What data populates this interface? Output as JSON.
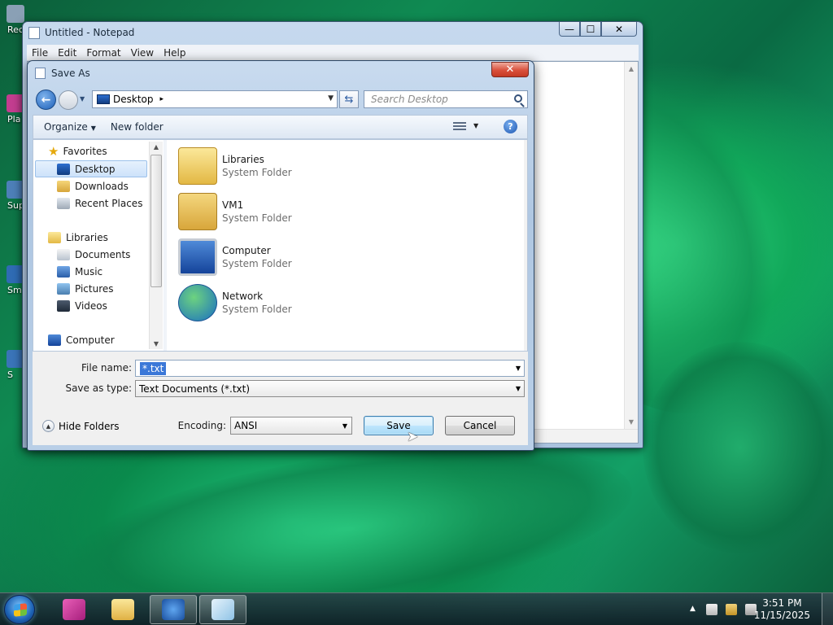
{
  "desktop": {
    "icons": [
      {
        "label": "Rec",
        "color": "#8aa0b5"
      },
      {
        "label": "Pla",
        "color": "#c23d8f"
      },
      {
        "label": "Sup",
        "color": "#4d7fb8"
      },
      {
        "label": "Sm",
        "color": "#2f6bb3"
      },
      {
        "label": "S",
        "color": "#3a74b8"
      }
    ]
  },
  "notepad": {
    "title": "Untitled - Notepad",
    "menu": [
      "File",
      "Edit",
      "Format",
      "View",
      "Help"
    ],
    "min_glyph": "—",
    "max_glyph": "☐",
    "close_glyph": "✕"
  },
  "dialog": {
    "title": "Save As",
    "close_glyph": "✕",
    "address": {
      "location": "Desktop",
      "sep": "▸",
      "dropdown": "▼"
    },
    "refresh_glyph": "⇆",
    "search_placeholder": "Search Desktop",
    "toolbar": {
      "organize": "Organize",
      "new_folder": "New folder",
      "caret": "▼"
    },
    "help_glyph": "?",
    "nav": {
      "favorites": "Favorites",
      "favorite_items": [
        "Desktop",
        "Downloads",
        "Recent Places"
      ],
      "libraries": "Libraries",
      "library_items": [
        "Documents",
        "Music",
        "Pictures",
        "Videos"
      ],
      "computer": "Computer",
      "selected": "Desktop"
    },
    "files": [
      {
        "name": "Libraries",
        "type": "System Folder",
        "icon": "libraries-folder-icon"
      },
      {
        "name": "VM1",
        "type": "System Folder",
        "icon": "user-folder-icon"
      },
      {
        "name": "Computer",
        "type": "System Folder",
        "icon": "computer-icon"
      },
      {
        "name": "Network",
        "type": "System Folder",
        "icon": "network-icon"
      }
    ],
    "file_name_label": "File name:",
    "file_name_value": "*.txt",
    "save_as_type_label": "Save as type:",
    "save_as_type_value": "Text Documents (*.txt)",
    "hide_folders": "Hide Folders",
    "encoding_label": "Encoding:",
    "encoding_value": "ANSI",
    "save": "Save",
    "cancel": "Cancel"
  },
  "taskbar": {
    "time": "3:51 PM",
    "date": "11/15/2025",
    "tray_arrow": "▲"
  },
  "colors": {
    "accent": "#3b78d8",
    "close_red": "#d9503c",
    "taskbar": "#1c2f38"
  }
}
